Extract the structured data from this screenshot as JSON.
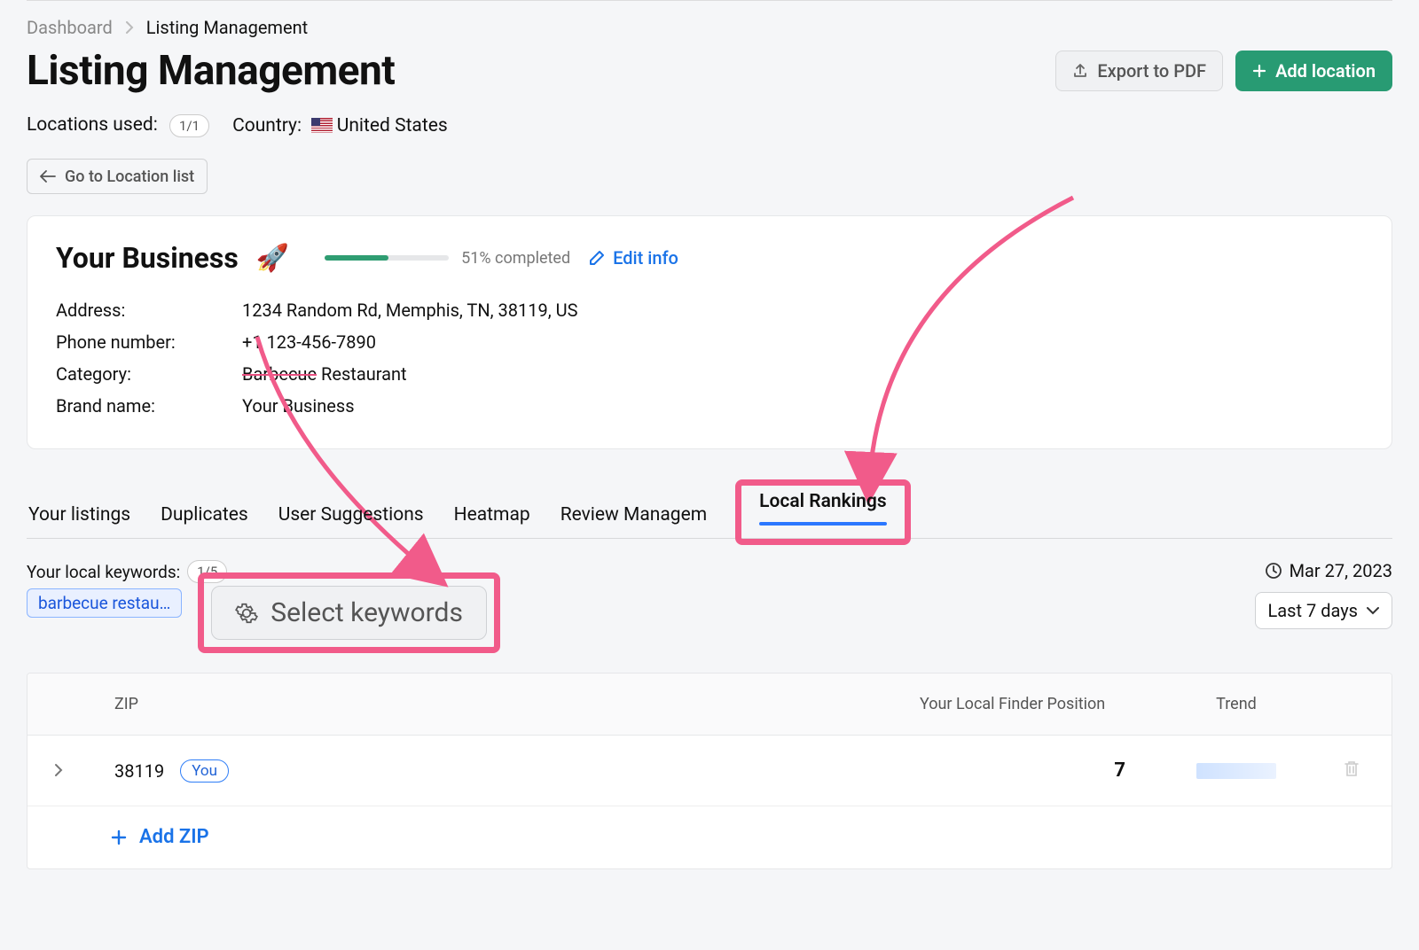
{
  "breadcrumb": {
    "root": "Dashboard",
    "current": "Listing Management"
  },
  "header": {
    "title": "Listing Management",
    "export_label": "Export to PDF",
    "add_location_label": "Add location"
  },
  "meta": {
    "locations_used_label": "Locations used:",
    "locations_used_value": "1/1",
    "country_label": "Country:",
    "country_value": "United States"
  },
  "back_button_label": "Go to Location list",
  "business": {
    "name": "Your Business",
    "progress_percent": 51,
    "progress_text": "51% completed",
    "edit_label": "Edit info",
    "fields": {
      "address_label": "Address:",
      "address_value": "1234 Random Rd, Memphis, TN, 38119, US",
      "phone_label": "Phone number:",
      "phone_value": "+1 123-456-7890",
      "category_label": "Category:",
      "category_value_strike": "Barbecue",
      "category_value_rest": " Restaurant",
      "brand_label": "Brand name:",
      "brand_value": "Your Business"
    }
  },
  "tabs": {
    "t0": "Your listings",
    "t1": "Duplicates",
    "t2": "User Suggestions",
    "t3": "Heatmap",
    "t4": "Review Managem",
    "t5": "Local Rankings"
  },
  "keywords": {
    "label": "Your local keywords:",
    "count": "1/5",
    "chip0": "barbecue restau…",
    "select_button": "Select keywords"
  },
  "date": {
    "current": "Mar 27, 2023",
    "range": "Last 7 days"
  },
  "table": {
    "col_zip": "ZIP",
    "col_pos": "Your Local Finder Position",
    "col_trend": "Trend",
    "rows": [
      {
        "zip": "38119",
        "you": "You",
        "position": "7"
      }
    ],
    "add_zip": "Add ZIP"
  }
}
